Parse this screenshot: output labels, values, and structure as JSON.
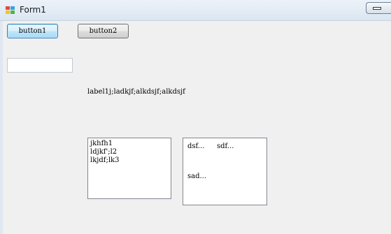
{
  "window": {
    "title": "Form1"
  },
  "buttons": {
    "button1": "button1",
    "button2": "button2"
  },
  "textbox": {
    "value": ""
  },
  "label1": {
    "text": "label1j;ladkjf;alkdsjf;alkdsjf"
  },
  "listbox": {
    "items": [
      "jkhfh1",
      "ldjkf';l2",
      "lkjdf;lk3"
    ]
  },
  "panel": {
    "label_a": "dsf...",
    "label_b": "sdf...",
    "label_c": "sad..."
  },
  "colors": {
    "title_bar": "#dbe6f2",
    "client_background": "#f0f0f0",
    "focus_border": "#3c7fb1"
  }
}
